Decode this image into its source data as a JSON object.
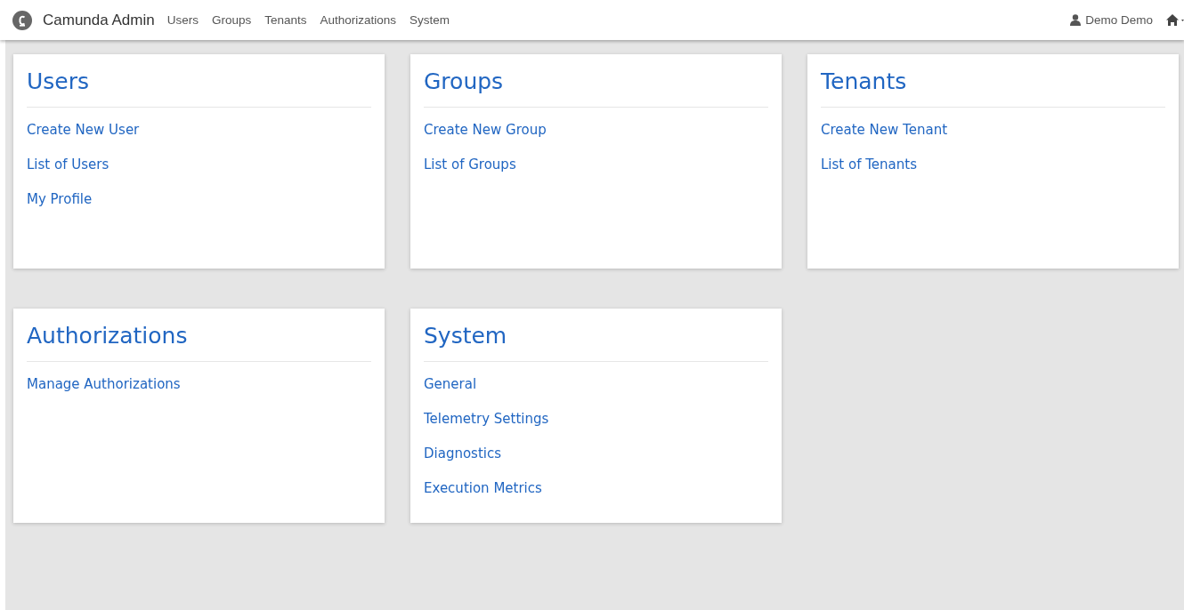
{
  "header": {
    "brand": "Camunda Admin",
    "nav": [
      {
        "label": "Users"
      },
      {
        "label": "Groups"
      },
      {
        "label": "Tenants"
      },
      {
        "label": "Authorizations"
      },
      {
        "label": "System"
      }
    ],
    "user": "Demo Demo"
  },
  "cards": [
    {
      "title": "Users",
      "links": [
        "Create New User",
        "List of Users",
        "My Profile"
      ]
    },
    {
      "title": "Groups",
      "links": [
        "Create New Group",
        "List of Groups"
      ]
    },
    {
      "title": "Tenants",
      "links": [
        "Create New Tenant",
        "List of Tenants"
      ]
    },
    {
      "title": "Authorizations",
      "links": [
        "Manage Authorizations"
      ]
    },
    {
      "title": "System",
      "links": [
        "General",
        "Telemetry Settings",
        "Diagnostics",
        "Execution Metrics"
      ]
    }
  ]
}
